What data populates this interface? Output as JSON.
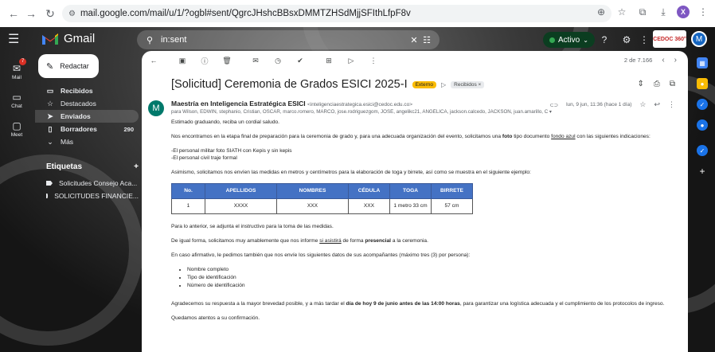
{
  "browser": {
    "url": "mail.google.com/mail/u/1/?ogbl#sent/QgrcJHshcBBsxDMMTZHSdMjjSFIthLfpF8v",
    "profile_initial": "X"
  },
  "gmail": {
    "app_name": "Gmail",
    "search_query": "in:sent",
    "status_label": "Activo",
    "org_logo_text": "CEDOC 360°",
    "user_initial": "M"
  },
  "rail": [
    {
      "label": "Mail",
      "badge": "7"
    },
    {
      "label": "Chat",
      "badge": ""
    },
    {
      "label": "Meet",
      "badge": ""
    }
  ],
  "compose_label": "Redactar",
  "sidebar": {
    "items": [
      {
        "label": "Recibidos",
        "count": "",
        "icon": "inbox-icon",
        "glyph": "▭"
      },
      {
        "label": "Destacados",
        "count": "",
        "icon": "star-icon",
        "glyph": "☆"
      },
      {
        "label": "Enviados",
        "count": "",
        "icon": "send-icon",
        "glyph": "➤"
      },
      {
        "label": "Borradores",
        "count": "290",
        "icon": "draft-icon",
        "glyph": "▯"
      },
      {
        "label": "Más",
        "count": "",
        "icon": "chevron-down-icon",
        "glyph": "⌄"
      }
    ],
    "labels_title": "Etiquetas",
    "labels": [
      {
        "label": "Solicitudes Consejo Aca..."
      },
      {
        "label": "SOLICITUDES FINANCIE..."
      }
    ]
  },
  "toolbar": {
    "pager_text": "2 de 7.166"
  },
  "email": {
    "subject": "[Solicitud] Ceremonia de Grados ESICI 2025-I",
    "tag_external": "Externo",
    "tag_inbox": "Recibidos ×",
    "sender_name": "Maestría en Inteligencia Estratégica ESICI",
    "sender_email": "<inteligenciaestrategica.esici@cedoc.edu.co>",
    "recipients": "para Wilson, EDWIN, stephanio, Cristian, OSCAR, marco.romero, MARCO, jose.rodriguezgom, JOSÉ, angelikc21, ANGÉLICA, jackson.calcedo, JACKSON, juan.amarillo, C ▾",
    "date": "lun, 9 jun, 11:36 (hace 1 día)",
    "greeting": "Estimado graduando, reciba un cordial saludo.",
    "para1_a": "Nos encontramos en la etapa final de preparación para la ceremonia de grado y, para una adecuada organización del evento, solicitamos una ",
    "para1_b": "foto",
    "para1_c": " tipo documento ",
    "para1_d": "fondo azul",
    "para1_e": " con las siguientes indicaciones:",
    "line_militar": "-El personal militar foto SIATH con Kepis y sin kepis",
    "line_civil": "-El personal civil traje formal",
    "para2": "Asimismo, solicitamos nos envíen las medidas en metros y centímetros para la elaboración de toga y birrete, así como se muestra en el siguiente ejemplo:",
    "table": {
      "headers": [
        "No.",
        "APELLIDOS",
        "NOMBRES",
        "CÉDULA",
        "TOGA",
        "BIRRETE"
      ],
      "rows": [
        [
          "1",
          "XXXX",
          "XXX",
          "XXX",
          "1 metro 33 cm",
          "57 cm"
        ]
      ]
    },
    "para3": "Para lo anterior, se adjunta el instructivo para la toma de las medidas.",
    "para4_a": "De igual forma,  solicitamos muy amablemente que nos informe ",
    "para4_b": "si asistirá",
    "para4_c": " de forma ",
    "para4_d": "presencial",
    "para4_e": " a la ceremonia.",
    "para5": "En caso afirmativo, le pedimos también que nos envíe los siguientes datos de sus acompañantes (máximo tres (3) por persona):",
    "list": [
      "Nombre completo",
      "Tipo de identificación",
      "Número de identificación"
    ],
    "para6_a": "Agradecemos su respuesta a la mayor brevedad posible, y a más tardar el ",
    "para6_b": " día de hoy 9 de junio antes de las 14:00 horas",
    "para6_c": ", para garantizar una logística adecuada y el cumplimiento de los protocolos de ingreso.",
    "para7": "Quedamos atentos a su confirmación."
  },
  "colors": {
    "table_header": "#4472c4",
    "tag_external": "#fbbc04",
    "status_green": "#34a853"
  }
}
